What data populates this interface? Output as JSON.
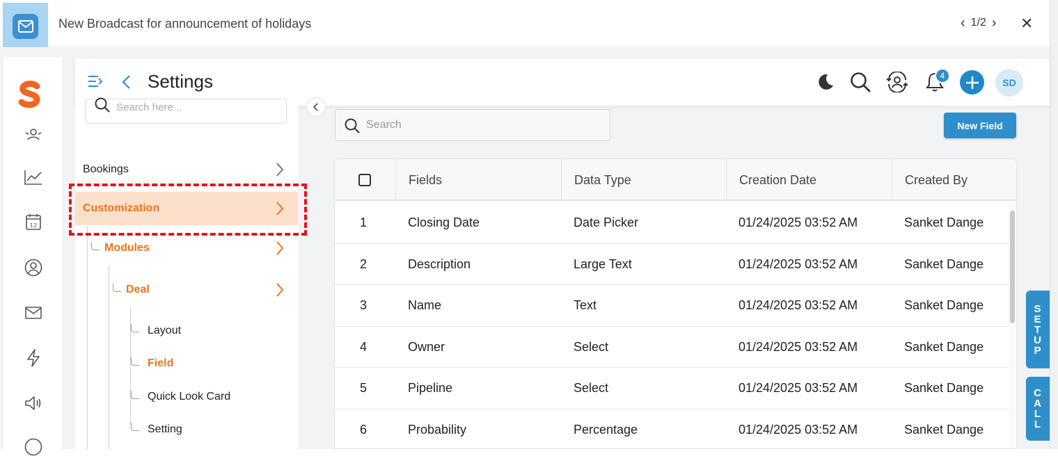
{
  "broadcast": {
    "title": "New Broadcast for announcement of holidays",
    "pager": "1/2"
  },
  "header": {
    "title": "Settings",
    "notification_count": "4",
    "avatar_initials": "SD"
  },
  "left_panel": {
    "search_placeholder": "Search here...",
    "items": {
      "bookings": "Bookings",
      "customization": "Customization",
      "modules": "Modules",
      "deal": "Deal",
      "layout": "Layout",
      "field": "Field",
      "quick_look_card": "Quick Look Card",
      "setting": "Setting"
    }
  },
  "main": {
    "search_placeholder": "Search",
    "new_field_label": "New Field",
    "columns": [
      "Fields",
      "Data Type",
      "Creation Date",
      "Created By"
    ],
    "rows": [
      {
        "num": "1",
        "field": "Closing Date",
        "type": "Date Picker",
        "date": "01/24/2025 03:52 AM",
        "by": "Sanket Dange"
      },
      {
        "num": "2",
        "field": "Description",
        "type": "Large Text",
        "date": "01/24/2025 03:52 AM",
        "by": "Sanket Dange"
      },
      {
        "num": "3",
        "field": "Name",
        "type": "Text",
        "date": "01/24/2025 03:52 AM",
        "by": "Sanket Dange"
      },
      {
        "num": "4",
        "field": "Owner",
        "type": "Select",
        "date": "01/24/2025 03:52 AM",
        "by": "Sanket Dange"
      },
      {
        "num": "5",
        "field": "Pipeline",
        "type": "Select",
        "date": "01/24/2025 03:52 AM",
        "by": "Sanket Dange"
      },
      {
        "num": "6",
        "field": "Probability",
        "type": "Percentage",
        "date": "01/24/2025 03:52 AM",
        "by": "Sanket Dange"
      }
    ]
  },
  "side_tabs": {
    "setup": [
      "S",
      "E",
      "T",
      "U",
      "P"
    ],
    "call": [
      "C",
      "A",
      "L",
      "L"
    ]
  },
  "colors": {
    "accent": "#2f8fca",
    "orange": "#f07418",
    "highlight": "#e3141b"
  }
}
